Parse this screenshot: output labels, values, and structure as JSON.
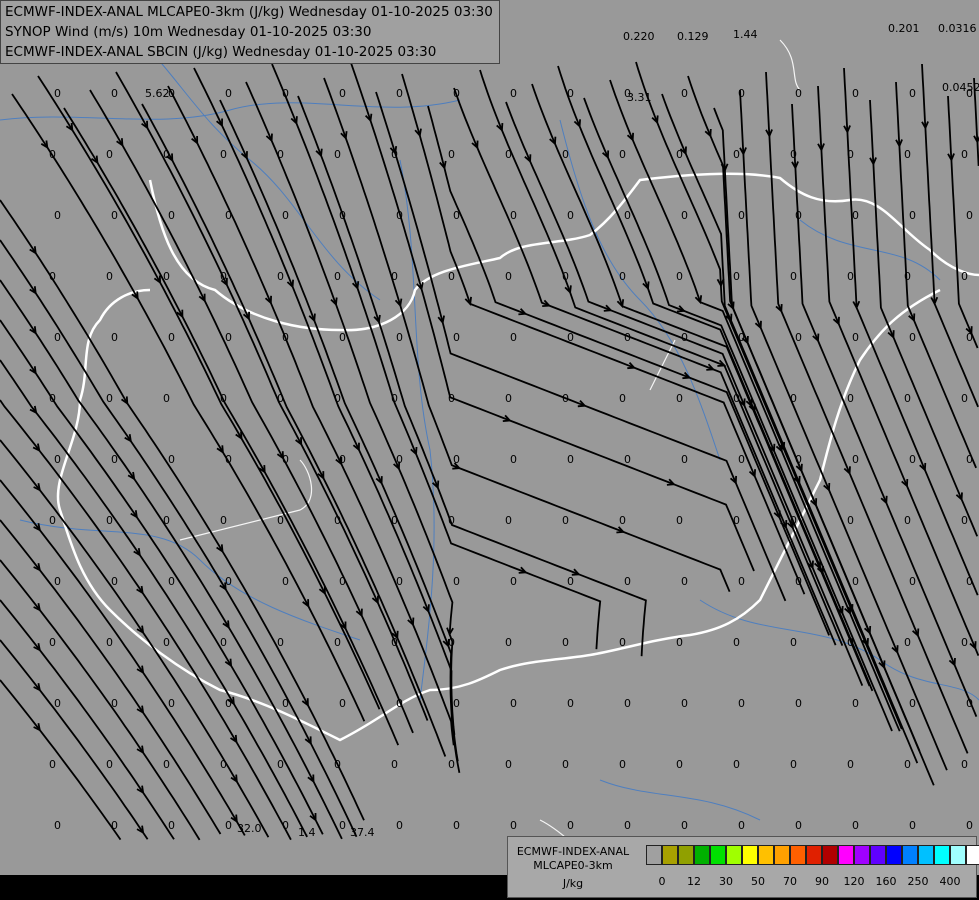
{
  "header": {
    "line1": "ECMWF-INDEX-ANAL MLCAPE0-3km (J/kg) Wednesday 01-10-2025 03:30",
    "line2": "SYNOP Wind (m/s) 10m Wednesday 01-10-2025 03:30",
    "line3": "ECMWF-INDEX-ANAL SBCIN (J/kg) Wednesday 01-10-2025 03:30"
  },
  "legend": {
    "title1": "ECMWF-INDEX-ANAL",
    "title2": "MLCAPE0-3km",
    "unit": "J/kg",
    "ticks": [
      "0",
      "12",
      "30",
      "50",
      "70",
      "90",
      "120",
      "160",
      "250",
      "400"
    ],
    "colors": [
      "#a0a0a0",
      "#a8a000",
      "#90a000",
      "#00b000",
      "#00e000",
      "#a0ff00",
      "#ffff00",
      "#ffc000",
      "#ffa000",
      "#ff6000",
      "#e02000",
      "#b00000",
      "#ff00ff",
      "#a000ff",
      "#6000ff",
      "#0000ff",
      "#0080ff",
      "#00c0ff",
      "#00ffff",
      "#a0ffff",
      "#ffffff"
    ]
  },
  "map": {
    "background": "#999999",
    "special_values": [
      "5.62",
      "3.31",
      "0.220",
      "0.129",
      "1.44",
      "0.201",
      "0.0316",
      "0.0452",
      "32.0",
      "1.4",
      "37.4"
    ]
  }
}
